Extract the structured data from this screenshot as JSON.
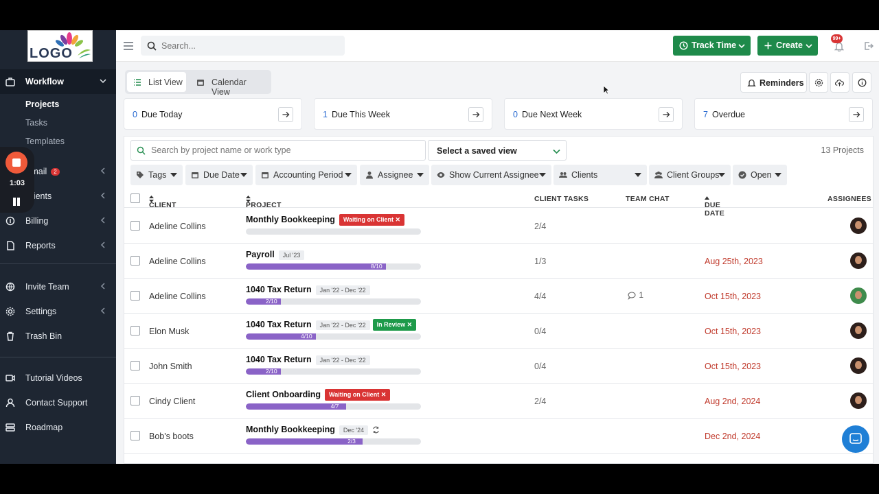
{
  "recorder": {
    "time": "1:03"
  },
  "logo": {
    "text": "LOGO"
  },
  "sidebar": {
    "workflow": "Workflow",
    "sub": [
      "Projects",
      "Tasks",
      "Templates"
    ],
    "email": "Email",
    "email_badge": "2",
    "clients": "Clients",
    "billing": "Billing",
    "reports": "Reports",
    "invite": "Invite Team",
    "settings": "Settings",
    "trash": "Trash Bin",
    "tutorial": "Tutorial Videos",
    "support": "Contact Support",
    "roadmap": "Roadmap"
  },
  "topbar": {
    "search_placeholder": "Search...",
    "track_time": "Track Time",
    "create": "Create",
    "notif_badge": "99+"
  },
  "views": {
    "list": "List View",
    "calendar": "Calendar View"
  },
  "reminders": "Reminders",
  "cards": [
    {
      "count": "0",
      "label": "Due Today"
    },
    {
      "count": "1",
      "label": "Due This Week"
    },
    {
      "count": "0",
      "label": "Due Next Week"
    },
    {
      "count": "7",
      "label": "Overdue"
    }
  ],
  "panel": {
    "search_placeholder": "Search by project name or work type",
    "saved_view": "Select a saved view",
    "count": "13 Projects"
  },
  "filters": [
    "Tags",
    "Due Date",
    "Accounting Period",
    "Assignee",
    "Show Current Assignee",
    "Clients",
    "Client Groups",
    "Open"
  ],
  "columns": {
    "client": "CLIENT",
    "project": "PROJECT",
    "tasks": "CLIENT TASKS",
    "chat": "TEAM CHAT",
    "due": "DUE DATE",
    "assignees": "ASSIGNEES"
  },
  "rows": [
    {
      "client": "Adeline Collins",
      "project": "Monthly Bookkeeping",
      "period": "",
      "tag": "Waiting on Client",
      "tag_color": "#d93434",
      "progress": "",
      "fraction": 0.0,
      "tasks": "2/4",
      "chat": "",
      "due": ""
    },
    {
      "client": "Adeline Collins",
      "project": "Payroll",
      "period": "Jul '23",
      "tag": "",
      "tag_color": "",
      "progress": "8/10",
      "fraction": 0.8,
      "tasks": "1/3",
      "chat": "",
      "due": "Aug 25th, 2023"
    },
    {
      "client": "Adeline Collins",
      "project": "1040 Tax Return",
      "period": "Jan '22 - Dec '22",
      "tag": "",
      "tag_color": "",
      "progress": "2/10",
      "fraction": 0.2,
      "tasks": "4/4",
      "chat": "1",
      "due": "Oct 15th, 2023"
    },
    {
      "client": "Elon Musk",
      "project": "1040 Tax Return",
      "period": "Jan '22 - Dec '22",
      "tag": "In Review",
      "tag_color": "#1e9a4a",
      "progress": "4/10",
      "fraction": 0.4,
      "tasks": "0/4",
      "chat": "",
      "due": "Oct 15th, 2023"
    },
    {
      "client": "John Smith",
      "project": "1040 Tax Return",
      "period": "Jan '22 - Dec '22",
      "tag": "",
      "tag_color": "",
      "progress": "2/10",
      "fraction": 0.2,
      "tasks": "0/4",
      "chat": "",
      "due": "Oct 15th, 2023"
    },
    {
      "client": "Cindy Client",
      "project": "Client Onboarding",
      "period": "",
      "tag": "Waiting on Client",
      "tag_color": "#d93434",
      "progress": "4/7",
      "fraction": 0.571,
      "tasks": "2/4",
      "chat": "",
      "due": "Aug 2nd, 2024"
    },
    {
      "client": "Bob's boots",
      "project": "Monthly Bookkeeping",
      "period": "Dec '24",
      "tag": "",
      "tag_color": "",
      "progress": "2/3",
      "fraction": 0.667,
      "tasks": "",
      "chat": "",
      "due": "Dec 2nd, 2024"
    }
  ]
}
